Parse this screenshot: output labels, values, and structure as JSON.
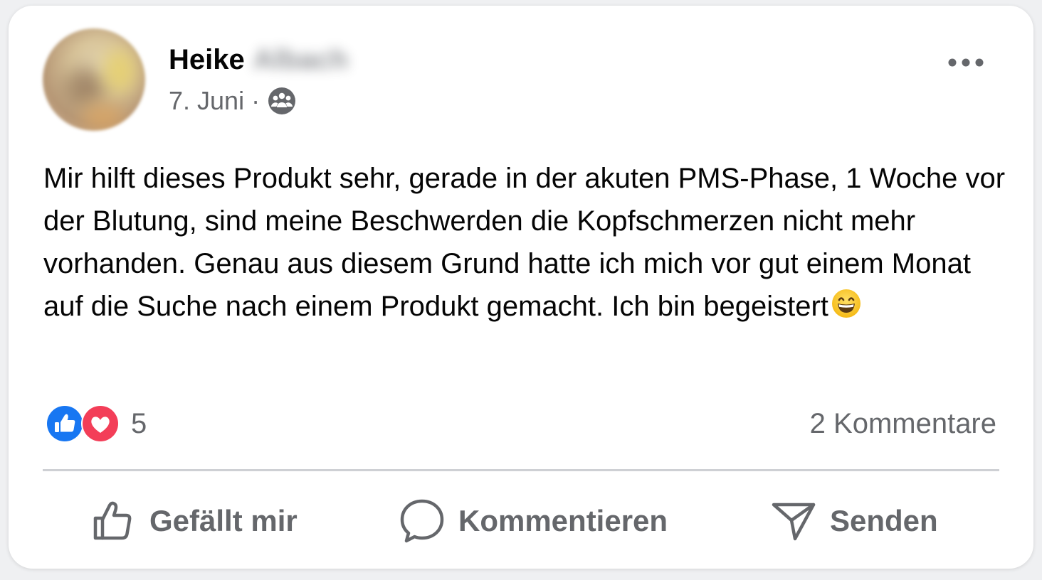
{
  "post": {
    "author_first_name": "Heike",
    "author_last_name_blurred": "Albach",
    "date": "7. Juni",
    "separator": "·",
    "audience_icon": "group-icon",
    "more_icon": "more-horizontal-icon",
    "text": "Mir hilft dieses Produkt sehr, gerade in der akuten PMS-Phase, 1 Woche vor der Blutung, sind meine Beschwerden die Kopfschmerzen nicht mehr vorhanden. Genau aus diesem Grund hatte ich mich vor gut einem Monat auf die Suche nach einem Produkt gemacht. Ich bin begeistert",
    "emoji": "grinning-face-emoji"
  },
  "reactions": {
    "icons": [
      "like-reaction-icon",
      "love-reaction-icon"
    ],
    "count": "5",
    "comments": "2 Kommentare"
  },
  "actions": {
    "like": "Gefällt mir",
    "comment": "Kommentieren",
    "send": "Senden"
  },
  "colors": {
    "like_blue": "#1877f2",
    "love_red": "#f33e58",
    "secondary_text": "#65676b",
    "primary_text": "#050505",
    "divider": "#ced0d4"
  }
}
